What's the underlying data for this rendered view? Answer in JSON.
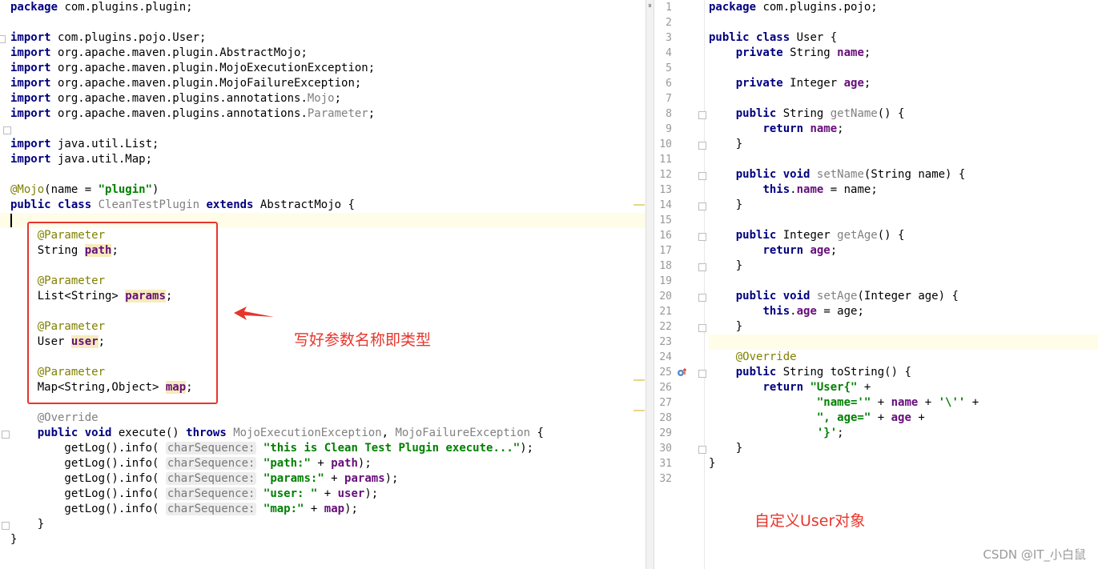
{
  "left_editor": {
    "lines": [
      {
        "t": "package com.plugins.plugin;"
      },
      {
        "t": ""
      },
      {
        "t": "import com.plugins.pojo.User;"
      },
      {
        "t": "import org.apache.maven.plugin.AbstractMojo;"
      },
      {
        "t": "import org.apache.maven.plugin.MojoExecutionException;"
      },
      {
        "t": "import org.apache.maven.plugin.MojoFailureException;"
      },
      {
        "t": "import org.apache.maven.plugins.annotations.Mojo;"
      },
      {
        "t": "import org.apache.maven.plugins.annotations.Parameter;"
      },
      {
        "t": ""
      },
      {
        "t": "import java.util.List;"
      },
      {
        "t": "import java.util.Map;"
      },
      {
        "t": ""
      },
      {
        "t": "@Mojo(name = \"plugin\")"
      },
      {
        "t": "public class CleanTestPlugin extends AbstractMojo {"
      },
      {
        "t": ""
      },
      {
        "t": "    @Parameter"
      },
      {
        "t": "    String path;"
      },
      {
        "t": ""
      },
      {
        "t": "    @Parameter"
      },
      {
        "t": "    List<String> params;"
      },
      {
        "t": ""
      },
      {
        "t": "    @Parameter"
      },
      {
        "t": "    User user;"
      },
      {
        "t": ""
      },
      {
        "t": "    @Parameter"
      },
      {
        "t": "    Map<String,Object> map;"
      },
      {
        "t": ""
      },
      {
        "t": "    @Override"
      },
      {
        "t": "    public void execute() throws MojoExecutionException, MojoFailureException {"
      },
      {
        "t": "        getLog().info( charSequence: \"this is Clean Test Plugin execute...\");"
      },
      {
        "t": "        getLog().info( charSequence: \"path:\" + path);"
      },
      {
        "t": "        getLog().info( charSequence: \"params:\" + params);"
      },
      {
        "t": "        getLog().info( charSequence: \"user: \" + user);"
      },
      {
        "t": "        getLog().info( charSequence: \"map:\" + map);"
      },
      {
        "t": "    }"
      },
      {
        "t": "}"
      }
    ]
  },
  "right_editor": {
    "line_numbers": [
      "1",
      "2",
      "3",
      "4",
      "5",
      "6",
      "7",
      "8",
      "9",
      "10",
      "11",
      "12",
      "13",
      "14",
      "15",
      "16",
      "17",
      "18",
      "19",
      "20",
      "21",
      "22",
      "23",
      "24",
      "25",
      "26",
      "27",
      "28",
      "29",
      "30",
      "31",
      "32"
    ],
    "lines": [
      {
        "t": "package com.plugins.pojo;"
      },
      {
        "t": ""
      },
      {
        "t": "public class User {"
      },
      {
        "t": "    private String name;"
      },
      {
        "t": ""
      },
      {
        "t": "    private Integer age;"
      },
      {
        "t": ""
      },
      {
        "t": "    public String getName() {"
      },
      {
        "t": "        return name;"
      },
      {
        "t": "    }"
      },
      {
        "t": ""
      },
      {
        "t": "    public void setName(String name) {"
      },
      {
        "t": "        this.name = name;"
      },
      {
        "t": "    }"
      },
      {
        "t": ""
      },
      {
        "t": "    public Integer getAge() {"
      },
      {
        "t": "        return age;"
      },
      {
        "t": "    }"
      },
      {
        "t": ""
      },
      {
        "t": "    public void setAge(Integer age) {"
      },
      {
        "t": "        this.age = age;"
      },
      {
        "t": "    }"
      },
      {
        "t": ""
      },
      {
        "t": "    @Override"
      },
      {
        "t": "    public String toString() {"
      },
      {
        "t": "        return \"User{\" +"
      },
      {
        "t": "                \"name='\" + name + '\\'' +"
      },
      {
        "t": "                \", age=\" + age +"
      },
      {
        "t": "                '}';"
      },
      {
        "t": "    }"
      },
      {
        "t": "}"
      },
      {
        "t": ""
      }
    ]
  },
  "annotations": {
    "params_note": "写好参数名称即类型",
    "user_note": "自定义User对象"
  },
  "watermark": "CSDN @IT_小白鼠",
  "icons": [
    "splitter-grip-icon",
    "fold-marker-icon",
    "override-method-icon",
    "arrow-icon"
  ],
  "colors": {
    "keyword": "#000080",
    "string": "#008000",
    "annotation": "#808000",
    "field": "#660e7a",
    "callout": "#e8352c"
  }
}
